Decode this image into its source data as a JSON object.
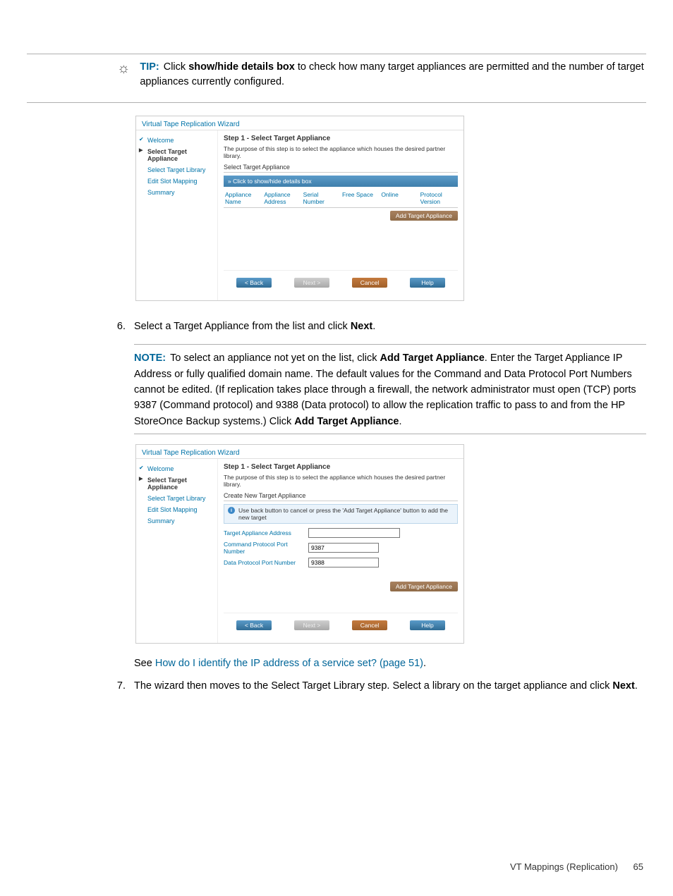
{
  "tip": {
    "label": "TIP:",
    "text_prefix": "Click ",
    "bold1": "show/hide details box",
    "text_suffix": " to check how many target appliances are permitted and the number of target appliances currently configured."
  },
  "wizard_common": {
    "title": "Virtual Tape Replication Wizard",
    "nav": {
      "welcome": "Welcome",
      "select_appliance": "Select Target Appliance",
      "select_library": "Select Target Library",
      "edit_slot": "Edit Slot Mapping",
      "summary": "Summary"
    },
    "step_title": "Step 1 - Select Target Appliance",
    "step_desc": "The purpose of this step is to select the appliance which houses the desired partner library.",
    "buttons": {
      "back": "< Back",
      "next": "Next >",
      "cancel": "Cancel",
      "help": "Help"
    },
    "add_btn": "Add Target Appliance"
  },
  "wizard1": {
    "subhead": "Select Target Appliance",
    "detailsbar": "Click to show/hide details box",
    "cols": {
      "name": "Appliance Name",
      "addr": "Appliance Address",
      "serial": "Serial Number",
      "free": "Free Space",
      "online": "Online",
      "proto": "Protocol Version"
    }
  },
  "step6": {
    "num": "6.",
    "text_prefix": "Select a Target Appliance from the list and click ",
    "bold": "Next",
    "text_suffix": "."
  },
  "note": {
    "label": "NOTE:",
    "t1": "To select an appliance not yet on the list, click ",
    "b1": "Add Target Appliance",
    "t2": ". Enter the Target Appliance IP Address or fully qualified domain name. The default values for the Command and Data Protocol Port Numbers cannot be edited. (If replication takes place through a firewall, the network administrator must open (TCP) ports 9387 (Command protocol) and 9388 (Data protocol) to allow the replication traffic to pass to and from the HP StoreOnce Backup systems.) Click ",
    "b2": "Add Target Appliance",
    "t3": "."
  },
  "wizard2": {
    "subhead": "Create New Target Appliance",
    "info": "Use back button to cancel or press the 'Add Target Appliance' button to add the new target",
    "fields": {
      "addr_label": "Target Appliance Address",
      "addr_value": "",
      "cmd_label": "Command Protocol Port Number",
      "cmd_value": "9387",
      "data_label": "Data Protocol Port Number",
      "data_value": "9388"
    }
  },
  "see": {
    "prefix": "See ",
    "link": "How do I identify the IP address of a service set? (page 51)",
    "suffix": "."
  },
  "step7": {
    "num": "7.",
    "t1": "The wizard then moves to the Select Target Library step. Select a library on the target appliance and click ",
    "b1": "Next",
    "t2": "."
  },
  "footer": {
    "section": "VT Mappings (Replication)",
    "page": "65"
  }
}
